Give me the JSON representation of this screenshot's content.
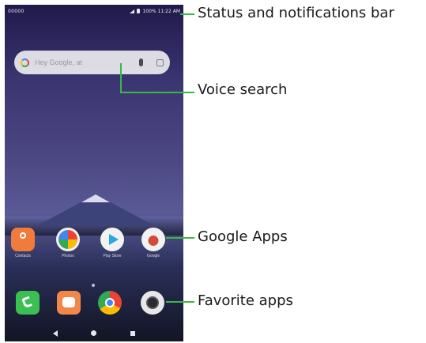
{
  "status_bar": {
    "carrier": "00000",
    "right_text": "100%  11:22 AM"
  },
  "search": {
    "placeholder": "Hey Google, at",
    "icons": [
      "google-g-icon",
      "mic-icon",
      "lens-icon"
    ]
  },
  "home_apps": [
    {
      "label": "Contacts",
      "icon": "contacts-icon"
    },
    {
      "label": "Photos",
      "icon": "photos-icon"
    },
    {
      "label": "Play Store",
      "icon": "play-store-icon"
    },
    {
      "label": "Google",
      "icon": "google-folder-icon"
    }
  ],
  "favorite_apps": [
    {
      "icon": "phone-icon"
    },
    {
      "icon": "messages-icon"
    },
    {
      "icon": "chrome-icon"
    },
    {
      "icon": "camera-icon"
    }
  ],
  "callouts": {
    "status": "Status and notifications bar",
    "voice": "Voice search",
    "google_apps": "Google Apps",
    "favorites": "Favorite apps"
  },
  "colors": {
    "callout_line": "#3cb54a"
  }
}
